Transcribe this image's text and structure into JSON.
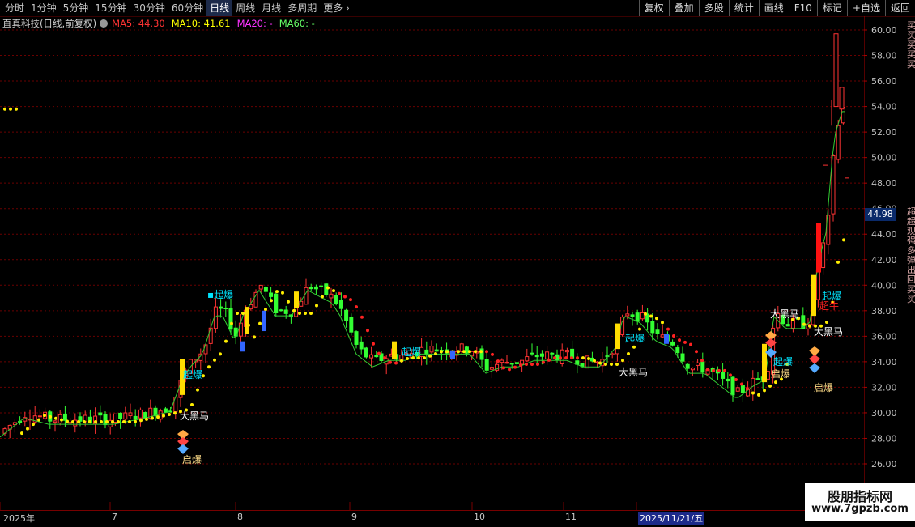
{
  "toolbar": {
    "periods": [
      "分时",
      "1分钟",
      "5分钟",
      "15分钟",
      "30分钟",
      "60分钟",
      "日线",
      "周线",
      "月线",
      "多周期",
      "更多"
    ],
    "active_period": "日线",
    "right_buttons": [
      "复权",
      "叠加",
      "多股",
      "统计",
      "画线",
      "F10",
      "标记",
      "+自选",
      "返回"
    ]
  },
  "legend": {
    "stock": "直真科技(日线,前复权)",
    "ma5": "MA5: 44.30",
    "ma10": "MA10: 41.61",
    "ma20": "MA20: -",
    "ma60": "MA60: -",
    "colors": {
      "ma5": "#ff3333",
      "ma10": "#ffff00",
      "ma20": "#ff33ff",
      "ma60": "#66ff66"
    }
  },
  "axis": {
    "ticks": [
      "60.00",
      "58.00",
      "56.00",
      "54.00",
      "52.00",
      "50.00",
      "48.00",
      "46.00",
      "44.00",
      "42.00",
      "40.00",
      "38.00",
      "36.00",
      "34.00",
      "32.00",
      "30.00",
      "28.00",
      "26.00"
    ],
    "current_price": "44.98"
  },
  "dates": {
    "year": "2025年",
    "months": [
      "7",
      "8",
      "9",
      "10",
      "11"
    ],
    "highlight": "2025/11/21/五"
  },
  "labels": {
    "qibao": "起爆",
    "daheima": "大黑马",
    "qibao2": "启爆",
    "zhuangniu": "超牛"
  },
  "side_strip": [
    "买",
    "买",
    "买",
    "买",
    "买",
    "超",
    "超",
    "观",
    "强",
    "多",
    "弹",
    "出",
    "回",
    "买",
    "买"
  ],
  "watermark": {
    "line1": "股朋指标网",
    "line2": "www.7gpzb.com"
  },
  "colors": {
    "up": "#ff3333",
    "down": "#33ff33",
    "grid": "#7a0000",
    "accent": "#ffff00"
  }
}
